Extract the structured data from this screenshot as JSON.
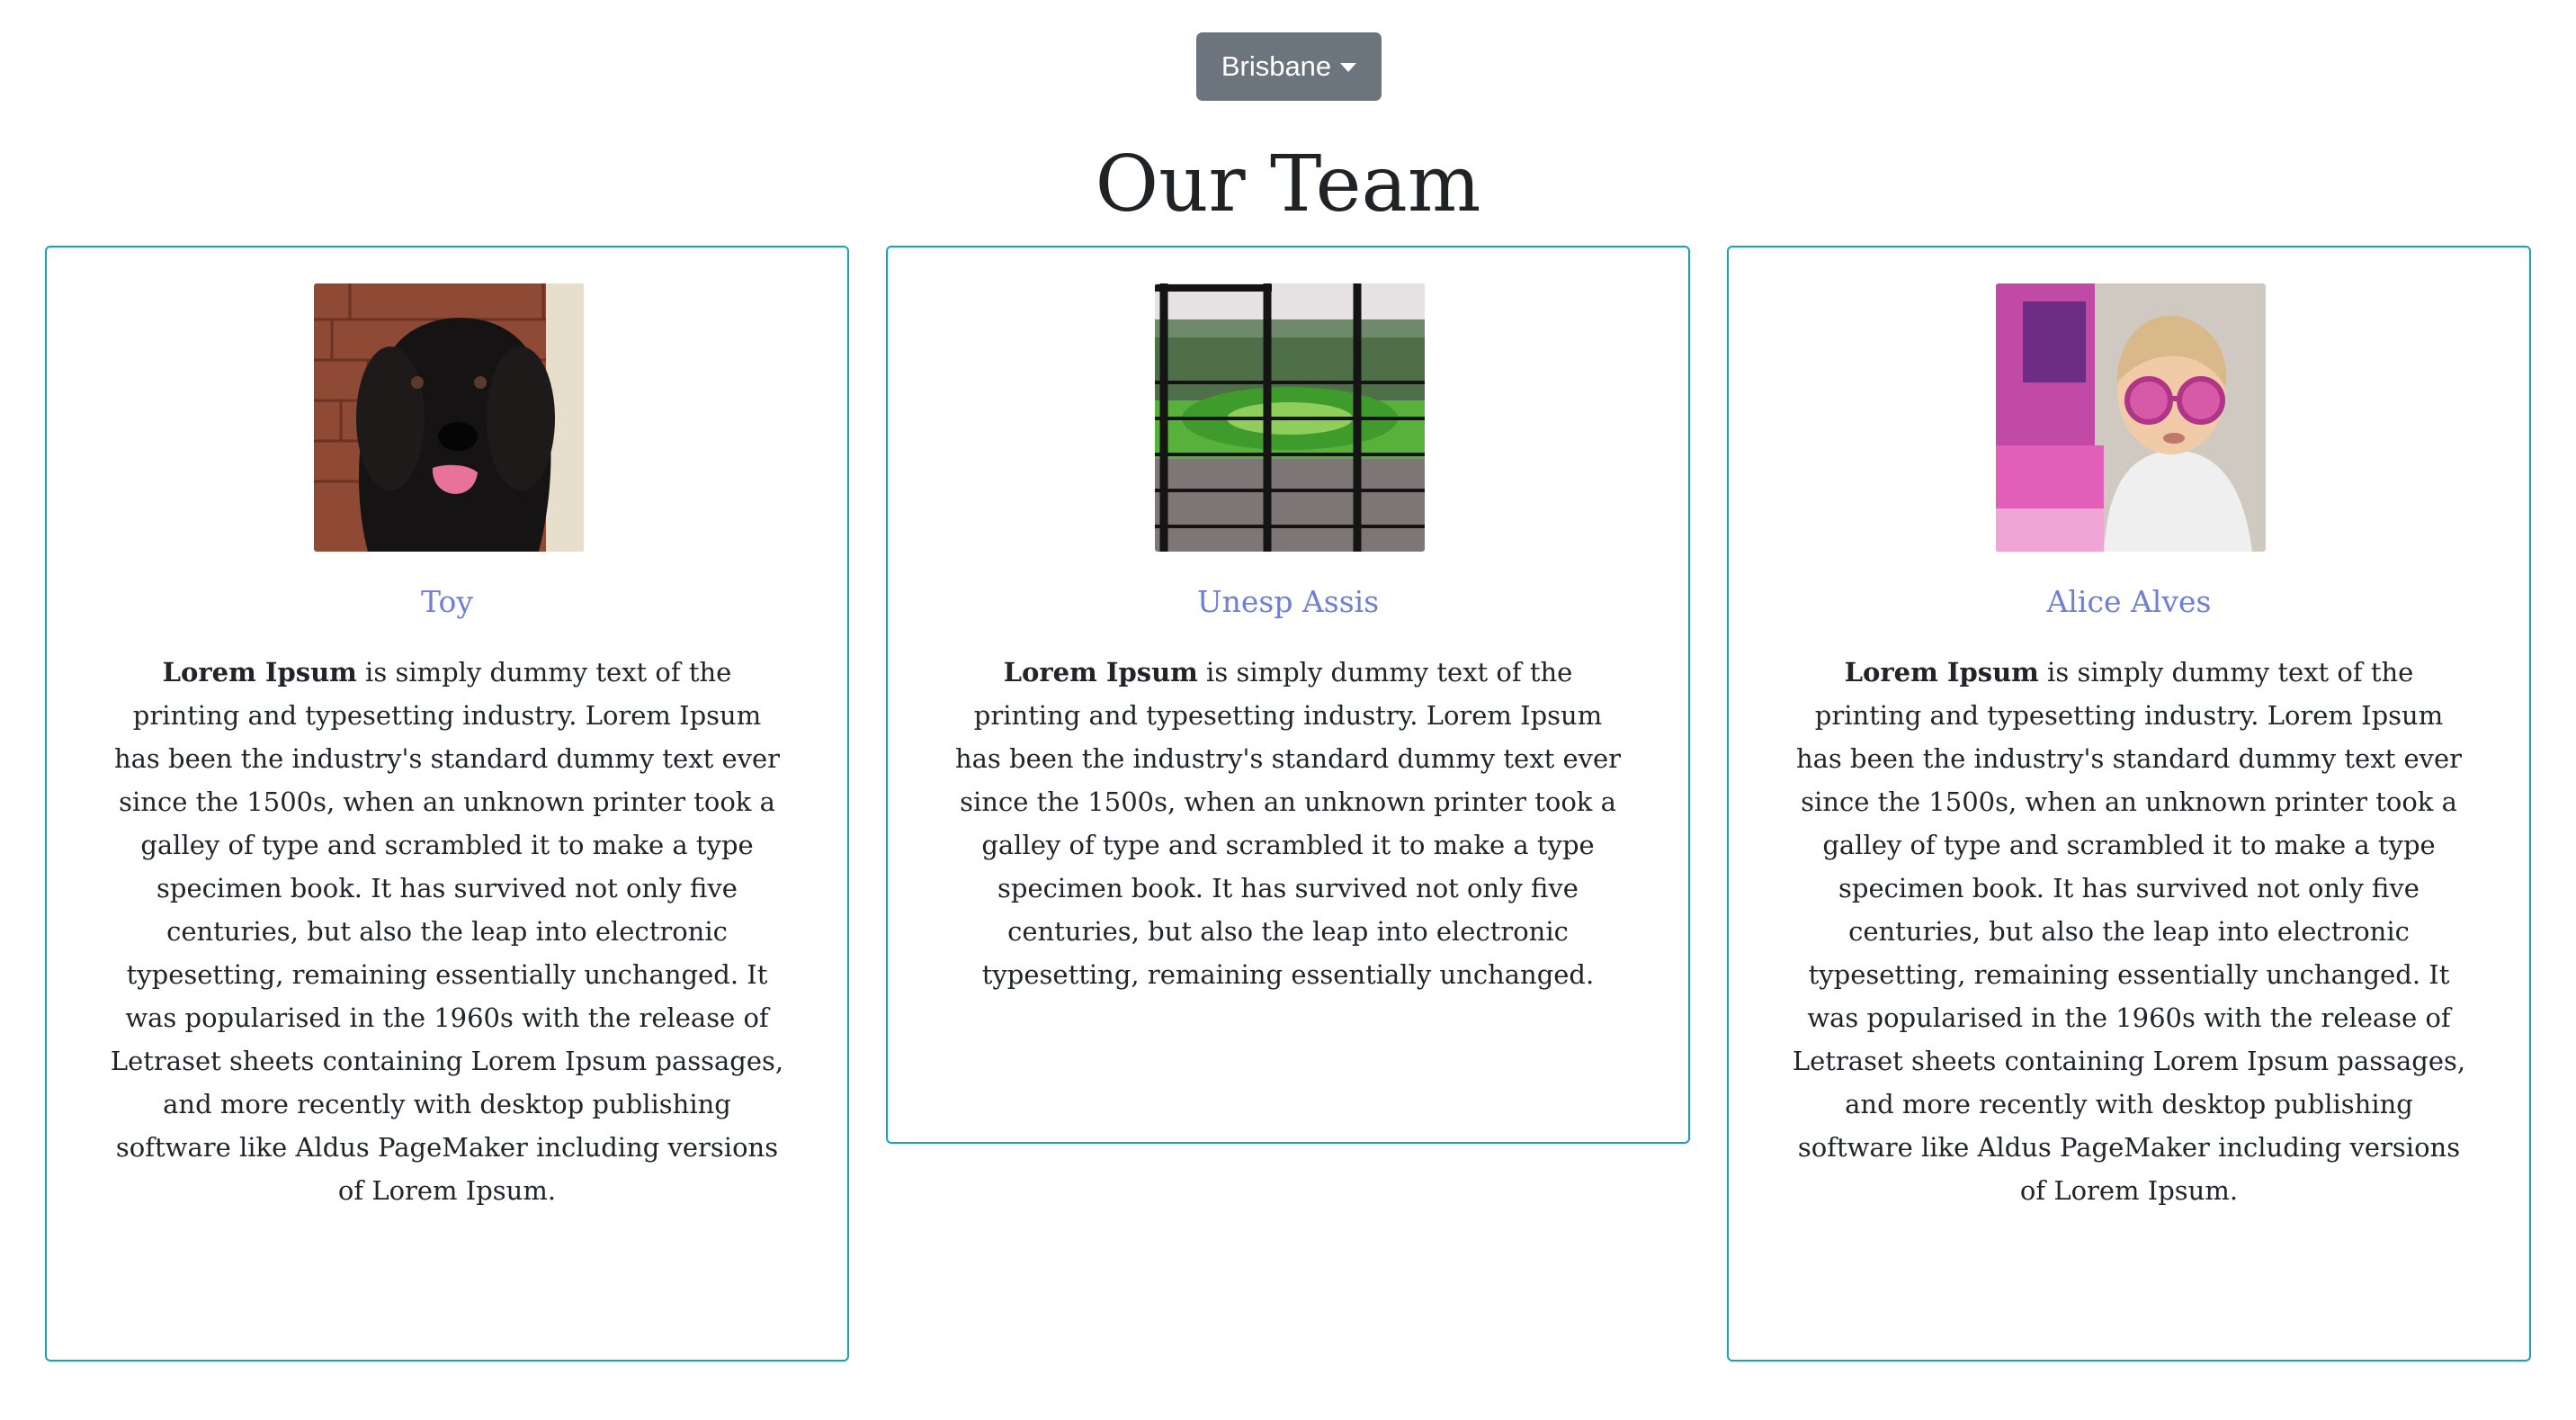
{
  "location_dropdown": {
    "selected": "Brisbane"
  },
  "page_title": "Our Team",
  "colors": {
    "dropdown_bg": "#6c757d",
    "card_border": "#17a2b8",
    "name_color": "#6f7fd6"
  },
  "team": [
    {
      "name": "Toy",
      "photo": "dog-photo",
      "bio_bold": "Lorem Ipsum",
      "bio_rest": " is simply dummy text of the printing and typesetting industry. Lorem Ipsum has been the industry's standard dummy text ever since the 1500s, when an unknown printer took a galley of type and scrambled it to make a type specimen book. It has survived not only five centuries, but also the leap into electronic typesetting, remaining essentially unchanged. It was popularised in the 1960s with the release of Letraset sheets containing Lorem Ipsum passages, and more recently with desktop publishing software like Aldus PageMaker including versions of Lorem Ipsum."
    },
    {
      "name": "Unesp Assis",
      "photo": "window-garden-photo",
      "bio_bold": "Lorem Ipsum",
      "bio_rest": " is simply dummy text of the printing and typesetting industry. Lorem Ipsum has been the industry's standard dummy text ever since the 1500s, when an unknown printer took a galley of type and scrambled it to make a type specimen book. It has survived not only five centuries, but also the leap into electronic typesetting, remaining essentially unchanged."
    },
    {
      "name": "Alice Alves",
      "photo": "child-sunglasses-photo",
      "bio_bold": "Lorem Ipsum",
      "bio_rest": " is simply dummy text of the printing and typesetting industry. Lorem Ipsum has been the industry's standard dummy text ever since the 1500s, when an unknown printer took a galley of type and scrambled it to make a type specimen book. It has survived not only five centuries, but also the leap into electronic typesetting, remaining essentially unchanged. It was popularised in the 1960s with the release of Letraset sheets containing Lorem Ipsum passages, and more recently with desktop publishing software like Aldus PageMaker including versions of Lorem Ipsum."
    }
  ]
}
